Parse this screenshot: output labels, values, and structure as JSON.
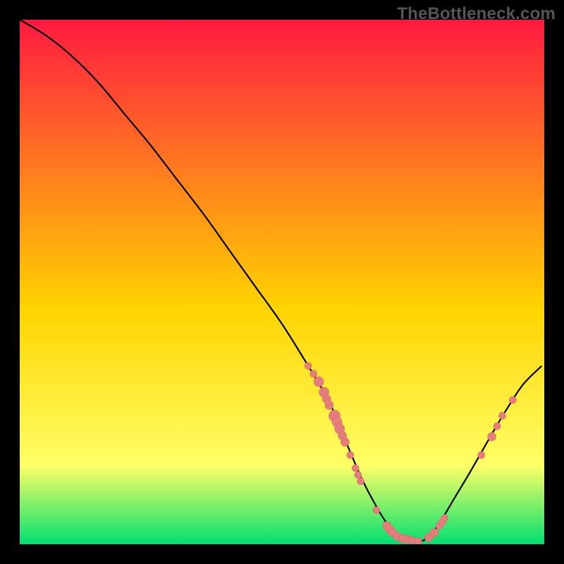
{
  "watermark": "TheBottleneck.com",
  "colors": {
    "frame": "#000000",
    "gradient_top": "#ff1a40",
    "gradient_mid": "#ffd400",
    "gradient_low": "#ffff66",
    "gradient_bottom": "#00e070",
    "curve": "#000000",
    "dot_fill": "#e57d7d",
    "dot_stroke": "#d66a6a"
  },
  "chart_data": {
    "type": "line",
    "title": "",
    "xlabel": "",
    "ylabel": "",
    "xlim": [
      0,
      100
    ],
    "ylim": [
      0,
      100
    ],
    "series": [
      {
        "name": "curve",
        "x": [
          0,
          5,
          10,
          15,
          20,
          25,
          30,
          35,
          40,
          45,
          50,
          55,
          58,
          60,
          62,
          65,
          67,
          70,
          73,
          76,
          78,
          80,
          83,
          86,
          90,
          93,
          96,
          99.5
        ],
        "y": [
          100,
          97,
          93,
          88,
          82,
          76,
          69.5,
          63,
          56,
          49,
          42,
          34,
          29,
          25,
          20,
          13,
          9,
          4,
          1.2,
          0.5,
          1.5,
          4,
          9,
          14,
          21,
          26,
          30.5,
          34
        ]
      }
    ],
    "scatter": [
      {
        "name": "dots",
        "points": [
          {
            "x": 55,
            "y": 34,
            "s": 5
          },
          {
            "x": 56,
            "y": 32.5,
            "s": 5
          },
          {
            "x": 57,
            "y": 31,
            "s": 7
          },
          {
            "x": 58,
            "y": 29,
            "s": 7
          },
          {
            "x": 58.5,
            "y": 27.7,
            "s": 6
          },
          {
            "x": 59,
            "y": 26.5,
            "s": 6
          },
          {
            "x": 60,
            "y": 24.5,
            "s": 8
          },
          {
            "x": 60.5,
            "y": 23.3,
            "s": 7
          },
          {
            "x": 61,
            "y": 22,
            "s": 7
          },
          {
            "x": 61.5,
            "y": 20.7,
            "s": 6
          },
          {
            "x": 62,
            "y": 19.5,
            "s": 6
          },
          {
            "x": 63,
            "y": 17,
            "s": 5
          },
          {
            "x": 64,
            "y": 14.5,
            "s": 5
          },
          {
            "x": 64.5,
            "y": 13.2,
            "s": 5
          },
          {
            "x": 65,
            "y": 12,
            "s": 5
          },
          {
            "x": 68,
            "y": 6.5,
            "s": 5
          },
          {
            "x": 70,
            "y": 3.5,
            "s": 6
          },
          {
            "x": 70.5,
            "y": 2.9,
            "s": 6
          },
          {
            "x": 71,
            "y": 2.3,
            "s": 6
          },
          {
            "x": 72,
            "y": 1.5,
            "s": 6
          },
          {
            "x": 73,
            "y": 1.1,
            "s": 6
          },
          {
            "x": 74,
            "y": 0.9,
            "s": 6
          },
          {
            "x": 74.5,
            "y": 0.8,
            "s": 5
          },
          {
            "x": 75,
            "y": 0.7,
            "s": 5
          },
          {
            "x": 76,
            "y": 0.6,
            "s": 5
          },
          {
            "x": 78,
            "y": 1.3,
            "s": 6
          },
          {
            "x": 79,
            "y": 2.2,
            "s": 6
          },
          {
            "x": 80,
            "y": 3.5,
            "s": 5
          },
          {
            "x": 80.5,
            "y": 4.2,
            "s": 5
          },
          {
            "x": 81,
            "y": 5,
            "s": 5
          },
          {
            "x": 88,
            "y": 17,
            "s": 5
          },
          {
            "x": 90,
            "y": 20.5,
            "s": 6
          },
          {
            "x": 91,
            "y": 22.5,
            "s": 5
          },
          {
            "x": 92,
            "y": 24.5,
            "s": 5
          },
          {
            "x": 94,
            "y": 27.5,
            "s": 5
          }
        ]
      }
    ]
  }
}
